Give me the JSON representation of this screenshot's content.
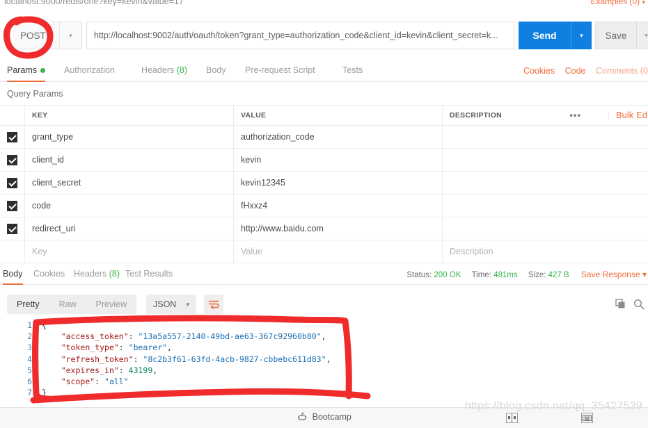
{
  "top_strip": {
    "tab_label": "localhost:9000/redis/one?key=kevin&value=17",
    "examples_label": "Examples (0)",
    "caret": "▾"
  },
  "request": {
    "method": "POST",
    "method_caret": "▾",
    "url": "http://localhost:9002/auth/oauth/token?grant_type=authorization_code&client_id=kevin&client_secret=k...",
    "send_label": "Send",
    "send_caret": "▾",
    "save_label": "Save",
    "save_caret": "▾",
    "tabs": [
      {
        "label": "Params",
        "has_dot": true,
        "active": true
      },
      {
        "label": "Authorization",
        "active": false
      },
      {
        "label": "Headers",
        "count": "(8)",
        "active": false
      },
      {
        "label": "Body",
        "active": false
      },
      {
        "label": "Pre-request Script",
        "active": false
      },
      {
        "label": "Tests",
        "active": false
      }
    ],
    "right_links": [
      {
        "label": "Cookies",
        "muted": false
      },
      {
        "label": "Code",
        "muted": false
      },
      {
        "label": "Comments (0",
        "muted": true
      }
    ]
  },
  "query_params": {
    "section_title": "Query Params",
    "columns": [
      "KEY",
      "VALUE",
      "DESCRIPTION"
    ],
    "dots": "•••",
    "bulk_edit_label": "Bulk Edit",
    "rows": [
      {
        "checked": true,
        "key": "grant_type",
        "value": "authorization_code",
        "description": ""
      },
      {
        "checked": true,
        "key": "client_id",
        "value": "kevin",
        "description": ""
      },
      {
        "checked": true,
        "key": "client_secret",
        "value": "kevin12345",
        "description": ""
      },
      {
        "checked": true,
        "key": "code",
        "value": "fHxxz4",
        "description": ""
      },
      {
        "checked": true,
        "key": "redirect_uri",
        "value": "http://www.baidu.com",
        "description": ""
      }
    ],
    "empty_row": {
      "key": "Key",
      "value": "Value",
      "description": "Description"
    }
  },
  "response": {
    "tabs": [
      {
        "label": "Body",
        "active": true
      },
      {
        "label": "Cookies",
        "active": false
      },
      {
        "label": "Headers",
        "count": "(8)",
        "active": false
      },
      {
        "label": "Test Results",
        "active": false
      }
    ],
    "status_label": "Status:",
    "status_value": "200 OK",
    "time_label": "Time:",
    "time_value": "481ms",
    "size_label": "Size:",
    "size_value": "427 B",
    "save_response_label": "Save Response",
    "save_response_caret": "▾",
    "view_modes": [
      {
        "label": "Pretty",
        "active": true
      },
      {
        "label": "Raw",
        "active": false
      },
      {
        "label": "Preview",
        "active": false
      }
    ],
    "format": "JSON",
    "format_caret": "▾",
    "line_numbers": [
      "1",
      "2",
      "3",
      "4",
      "5",
      "6",
      "7"
    ],
    "body_lines": [
      {
        "indent": 0,
        "tokens": [
          {
            "t": "p",
            "v": "{"
          }
        ]
      },
      {
        "indent": 1,
        "tokens": [
          {
            "t": "k",
            "v": "\"access_token\""
          },
          {
            "t": "p",
            "v": ": "
          },
          {
            "t": "s",
            "v": "\"13a5a557-2140-49bd-ae63-367c92960b80\""
          },
          {
            "t": "p",
            "v": ","
          }
        ]
      },
      {
        "indent": 1,
        "tokens": [
          {
            "t": "k",
            "v": "\"token_type\""
          },
          {
            "t": "p",
            "v": ": "
          },
          {
            "t": "s",
            "v": "\"bearer\""
          },
          {
            "t": "p",
            "v": ","
          }
        ]
      },
      {
        "indent": 1,
        "tokens": [
          {
            "t": "k",
            "v": "\"refresh_token\""
          },
          {
            "t": "p",
            "v": ": "
          },
          {
            "t": "s",
            "v": "\"8c2b3f61-63fd-4acb-9827-cbbebc611d83\""
          },
          {
            "t": "p",
            "v": ","
          }
        ]
      },
      {
        "indent": 1,
        "tokens": [
          {
            "t": "k",
            "v": "\"expires_in\""
          },
          {
            "t": "p",
            "v": ": "
          },
          {
            "t": "n",
            "v": "43199"
          },
          {
            "t": "p",
            "v": ","
          }
        ]
      },
      {
        "indent": 1,
        "tokens": [
          {
            "t": "k",
            "v": "\"scope\""
          },
          {
            "t": "p",
            "v": ": "
          },
          {
            "t": "s",
            "v": "\"all\""
          }
        ]
      },
      {
        "indent": 0,
        "tokens": [
          {
            "t": "p",
            "v": "}"
          }
        ]
      }
    ]
  },
  "footer": {
    "bootcamp_label": "Bootcamp",
    "watermark": "https://blog.csdn.net/qq_35427539"
  },
  "colors": {
    "accent_orange": "#f26b3a",
    "send_blue": "#1080e0",
    "status_green": "#39b54a",
    "annotation_red": "#ef2b2b"
  }
}
